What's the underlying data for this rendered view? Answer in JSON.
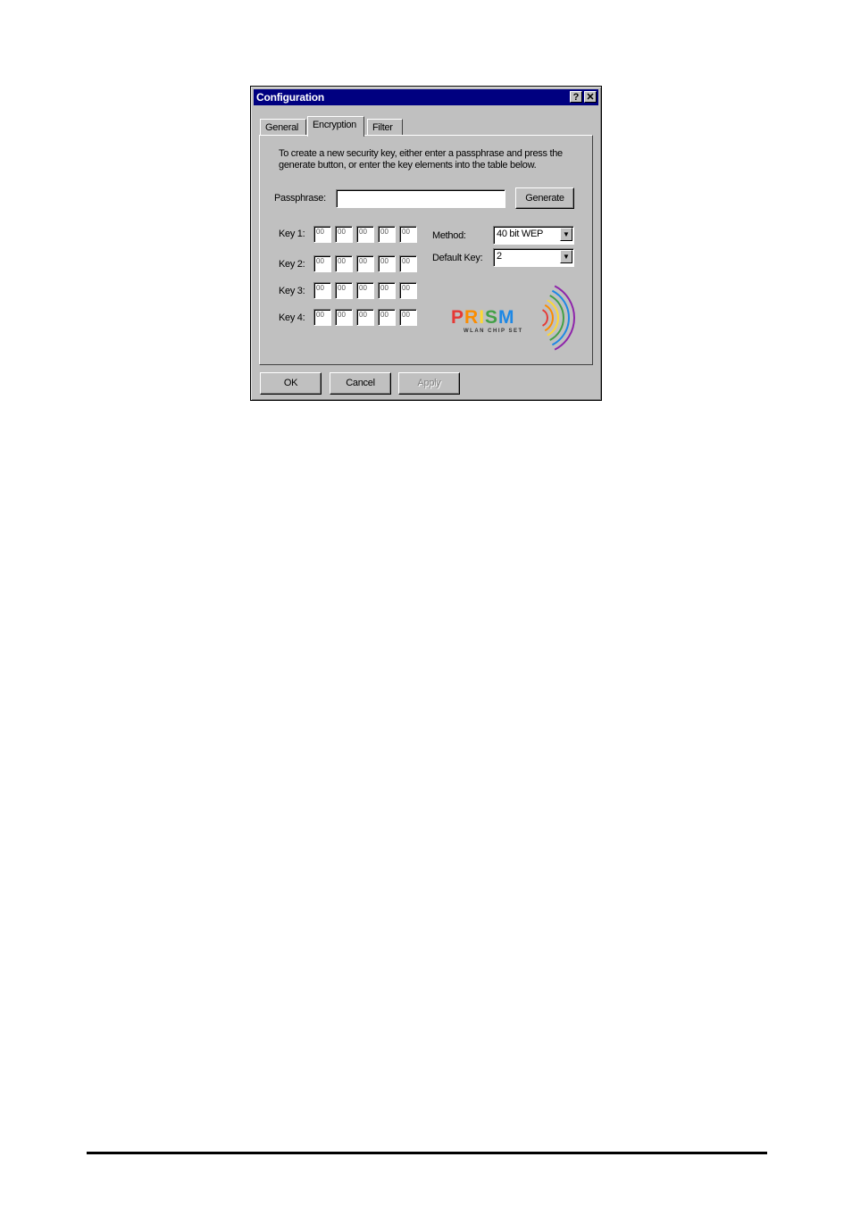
{
  "window": {
    "title": "Configuration",
    "help_glyph": "?",
    "close_glyph": "✕"
  },
  "tabs": [
    {
      "label": "General"
    },
    {
      "label": "Encryption"
    },
    {
      "label": "Filter"
    }
  ],
  "encryption": {
    "instruction": "To create a new security key, either enter a passphrase and press the generate button, or enter the key elements into the table below.",
    "passphrase_label": "Passphrase:",
    "passphrase_value": "",
    "generate_label": "Generate",
    "keys": [
      {
        "label": "Key 1:",
        "values": [
          "00",
          "00",
          "00",
          "00",
          "00"
        ]
      },
      {
        "label": "Key 2:",
        "values": [
          "00",
          "00",
          "00",
          "00",
          "00"
        ]
      },
      {
        "label": "Key 3:",
        "values": [
          "00",
          "00",
          "00",
          "00",
          "00"
        ]
      },
      {
        "label": "Key 4:",
        "values": [
          "00",
          "00",
          "00",
          "00",
          "00"
        ]
      }
    ],
    "method_label": "Method:",
    "method_value": "40 bit WEP",
    "default_key_label": "Default Key:",
    "default_key_value": "2"
  },
  "logo": {
    "brand": "PRISM",
    "tagline": "WLAN CHIP SET",
    "colors": [
      "#e53935",
      "#fb8c00",
      "#fdd835",
      "#43a047",
      "#1e88e5",
      "#8e24aa"
    ]
  },
  "buttons": {
    "ok": "OK",
    "cancel": "Cancel",
    "apply": "Apply"
  }
}
